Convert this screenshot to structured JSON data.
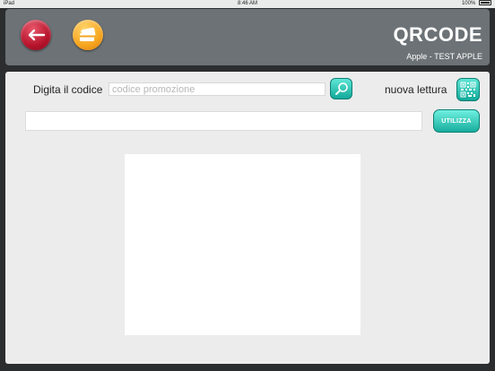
{
  "status_bar": {
    "carrier": "iPad",
    "time": "8:46 AM",
    "battery": "100%"
  },
  "header": {
    "title": "QRCODE",
    "subtitle": "Apple - TEST APPLE",
    "back_icon": "arrow-left-icon",
    "card_icon": "card-icon"
  },
  "form": {
    "code_label": "Digita il codice",
    "code_placeholder": "codice promozione",
    "code_value": "",
    "new_scan_label": "nuova lettura",
    "wide_value": "",
    "use_button": "UTILIZZA"
  },
  "colors": {
    "header_bg": "#6c7276",
    "content_bg": "#ececec",
    "accent_teal": "#12a99a",
    "back_red": "#b6142c",
    "card_orange": "#f6a51f"
  }
}
